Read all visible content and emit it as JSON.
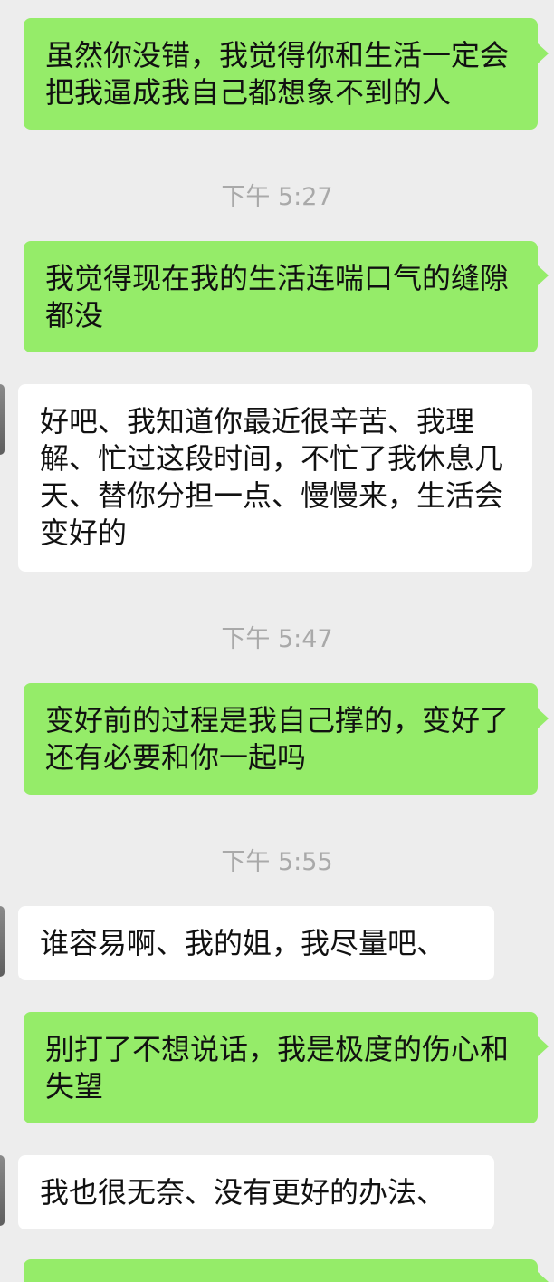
{
  "messages": [
    {
      "type": "out",
      "text": "虽然你没错，我觉得你和生活一定会把我逼成我自己都想象不到的人"
    },
    {
      "type": "time",
      "text": "下午 5:27"
    },
    {
      "type": "out",
      "text": "我觉得现在我的生活连喘口气的缝隙都没"
    },
    {
      "type": "in",
      "text": "好吧、我知道你最近很辛苦、我理解、忙过这段时间，不忙了我休息几天、替你分担一点、慢慢来，生活会变好的"
    },
    {
      "type": "time",
      "text": "下午 5:47"
    },
    {
      "type": "out",
      "text": "变好前的过程是我自己撑的，变好了还有必要和你一起吗"
    },
    {
      "type": "time",
      "text": "下午 5:55"
    },
    {
      "type": "in",
      "text": "谁容易啊、我的姐，我尽量吧、"
    },
    {
      "type": "out",
      "text": "别打了不想说话，我是极度的伤心和失望"
    },
    {
      "type": "in",
      "text": "我也很无奈、没有更好的办法、"
    },
    {
      "type": "out",
      "text": ""
    }
  ]
}
